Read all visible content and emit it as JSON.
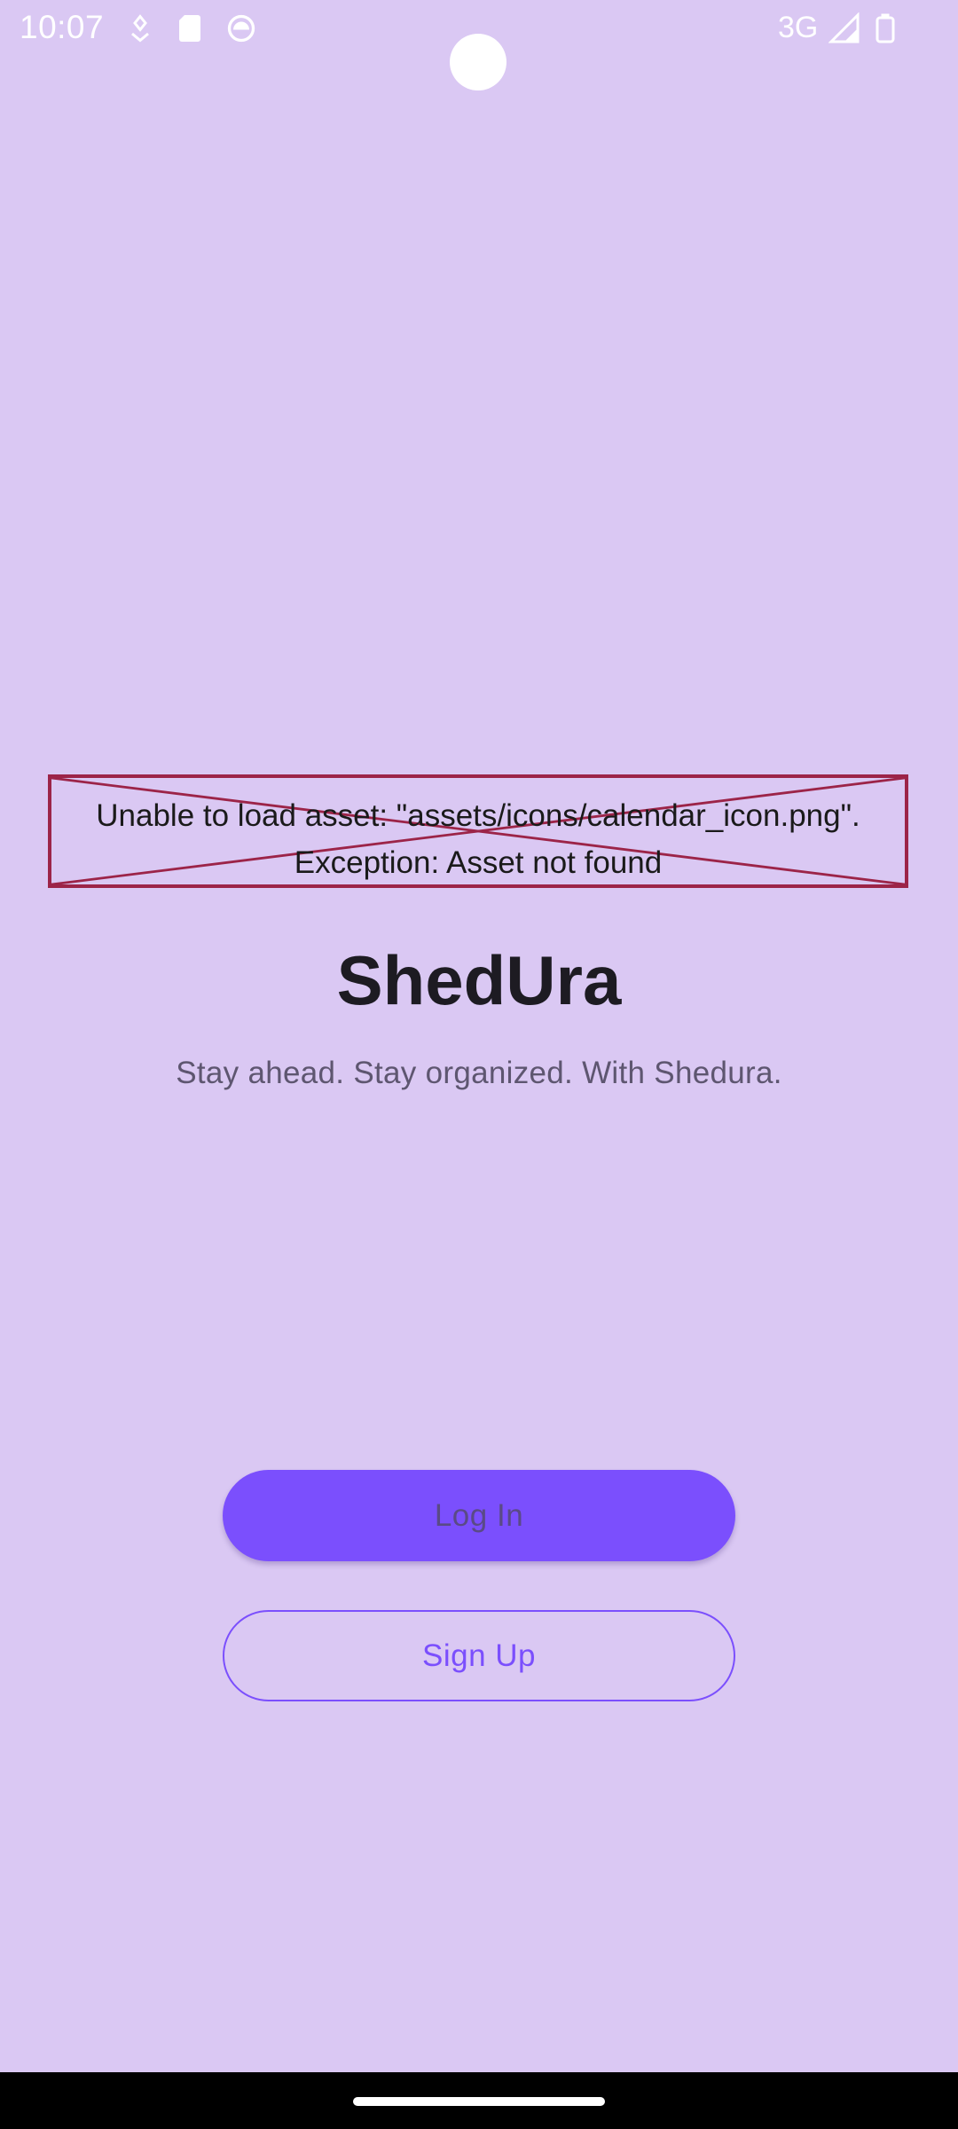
{
  "status_bar": {
    "time": "10:07",
    "network": "3G",
    "icons": [
      "location-pin-icon",
      "sd-card-icon",
      "android-icon",
      "signal-icon",
      "battery-icon"
    ]
  },
  "asset_error": {
    "line1": "Unable to load asset: \"assets/icons/calendar_icon.png\".",
    "line2": "Exception: Asset not found",
    "border_color": "#9c2448"
  },
  "app": {
    "title": "ShedUra",
    "tagline": "Stay ahead. Stay organized. With Shedura."
  },
  "actions": {
    "login_label": "Log In",
    "signup_label": "Sign Up"
  },
  "colors": {
    "background": "#dac8f3",
    "accent": "#7b4ffd"
  }
}
